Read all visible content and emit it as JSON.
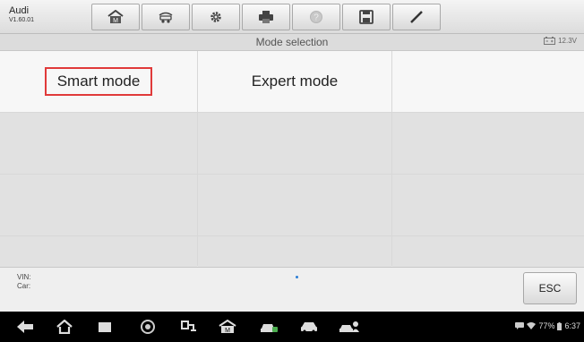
{
  "app": {
    "brand": "Audi",
    "version": "V1.60.01"
  },
  "toolbar": {
    "items": [
      {
        "icon": "home-icon"
      },
      {
        "icon": "vehicle-lift-icon"
      },
      {
        "icon": "settings-icon"
      },
      {
        "icon": "print-icon"
      },
      {
        "icon": "help-icon"
      },
      {
        "icon": "save-icon"
      },
      {
        "icon": "edit-icon"
      }
    ]
  },
  "header": {
    "title": "Mode selection",
    "battery_voltage": "12.3V"
  },
  "modes": {
    "smart": "Smart mode",
    "expert": "Expert mode"
  },
  "footer": {
    "vin_label": "VIN:",
    "car_label": "Car:",
    "esc_label": "ESC"
  },
  "system": {
    "battery_percent": "77%",
    "time": "6:37"
  },
  "colors": {
    "highlight": "#e03a3a",
    "page_dot": "#2c7ed6"
  }
}
